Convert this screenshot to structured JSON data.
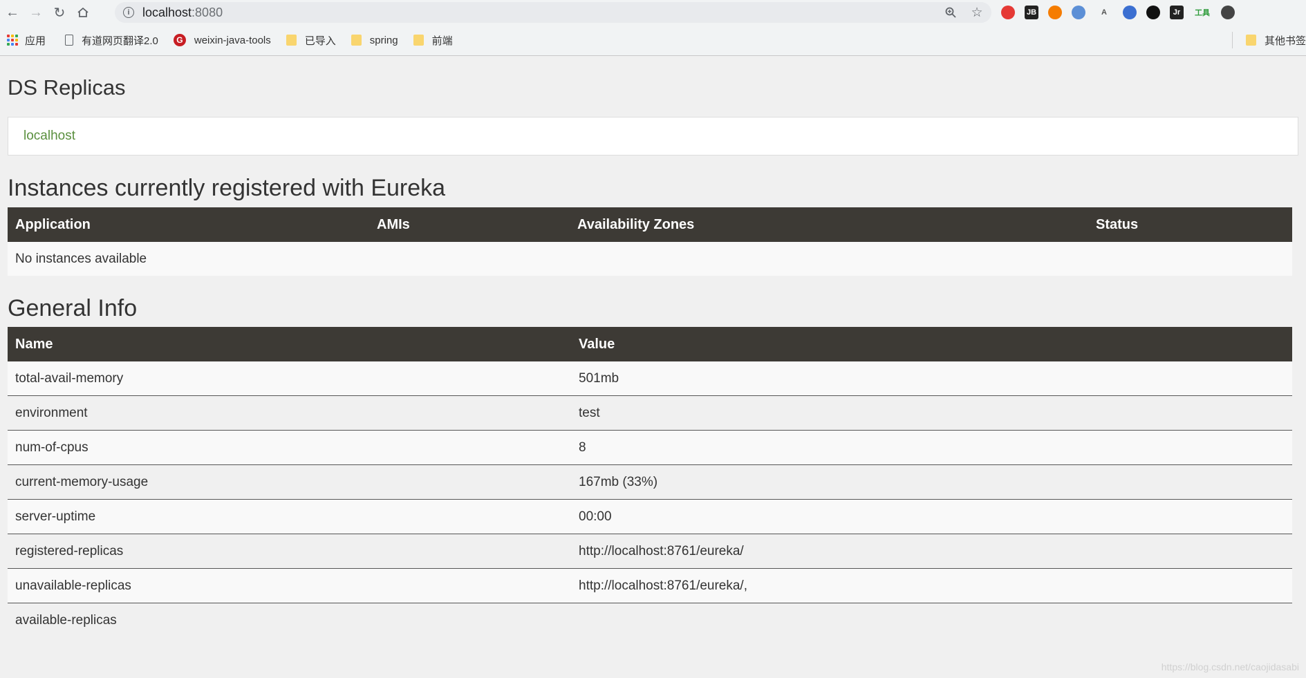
{
  "browser": {
    "url_host": "localhost",
    "url_port": ":8080",
    "extensions": [
      {
        "name": "adblock-icon",
        "label": "",
        "color": "#e53935"
      },
      {
        "name": "jetbrains-icon",
        "label": "JB",
        "color": "#222222"
      },
      {
        "name": "extension-orange-icon",
        "label": "",
        "color": "#f57c00"
      },
      {
        "name": "extension-blue-icon",
        "label": "",
        "color": "#5c8fd6"
      },
      {
        "name": "extension-a-icon",
        "label": "A",
        "color": "#555555"
      },
      {
        "name": "translate-icon",
        "label": "",
        "color": "#3b6fd1"
      },
      {
        "name": "extension-circle-icon",
        "label": "",
        "color": "#111111"
      },
      {
        "name": "extension-jr-icon",
        "label": "Jr",
        "color": "#222222"
      },
      {
        "name": "tools-icon",
        "label": "工具",
        "color": "#2e9b3a"
      },
      {
        "name": "profile-avatar-icon",
        "label": "",
        "color": "#444444"
      }
    ]
  },
  "bookmarks": {
    "items": [
      {
        "label": "应用"
      },
      {
        "label": "有道网页翻译2.0"
      },
      {
        "label": "weixin-java-tools"
      },
      {
        "label": "已导入"
      },
      {
        "label": "spring"
      },
      {
        "label": "前端"
      }
    ],
    "other": "其他书签"
  },
  "page": {
    "title": "DS Replicas",
    "replica_link": "localhost",
    "instances_heading": "Instances currently registered with Eureka",
    "instances_columns": [
      "Application",
      "AMIs",
      "Availability Zones",
      "Status"
    ],
    "no_instances": "No instances available",
    "general_heading": "General Info",
    "general_columns": [
      "Name",
      "Value"
    ],
    "general_rows": [
      {
        "name": "total-avail-memory",
        "value": "501mb"
      },
      {
        "name": "environment",
        "value": "test"
      },
      {
        "name": "num-of-cpus",
        "value": "8"
      },
      {
        "name": "current-memory-usage",
        "value": "167mb (33%)"
      },
      {
        "name": "server-uptime",
        "value": "00:00"
      },
      {
        "name": "registered-replicas",
        "value": "http://localhost:8761/eureka/"
      },
      {
        "name": "unavailable-replicas",
        "value": "http://localhost:8761/eureka/,"
      },
      {
        "name": "available-replicas",
        "value": ""
      }
    ]
  },
  "watermark": "https://blog.csdn.net/caojidasabi"
}
